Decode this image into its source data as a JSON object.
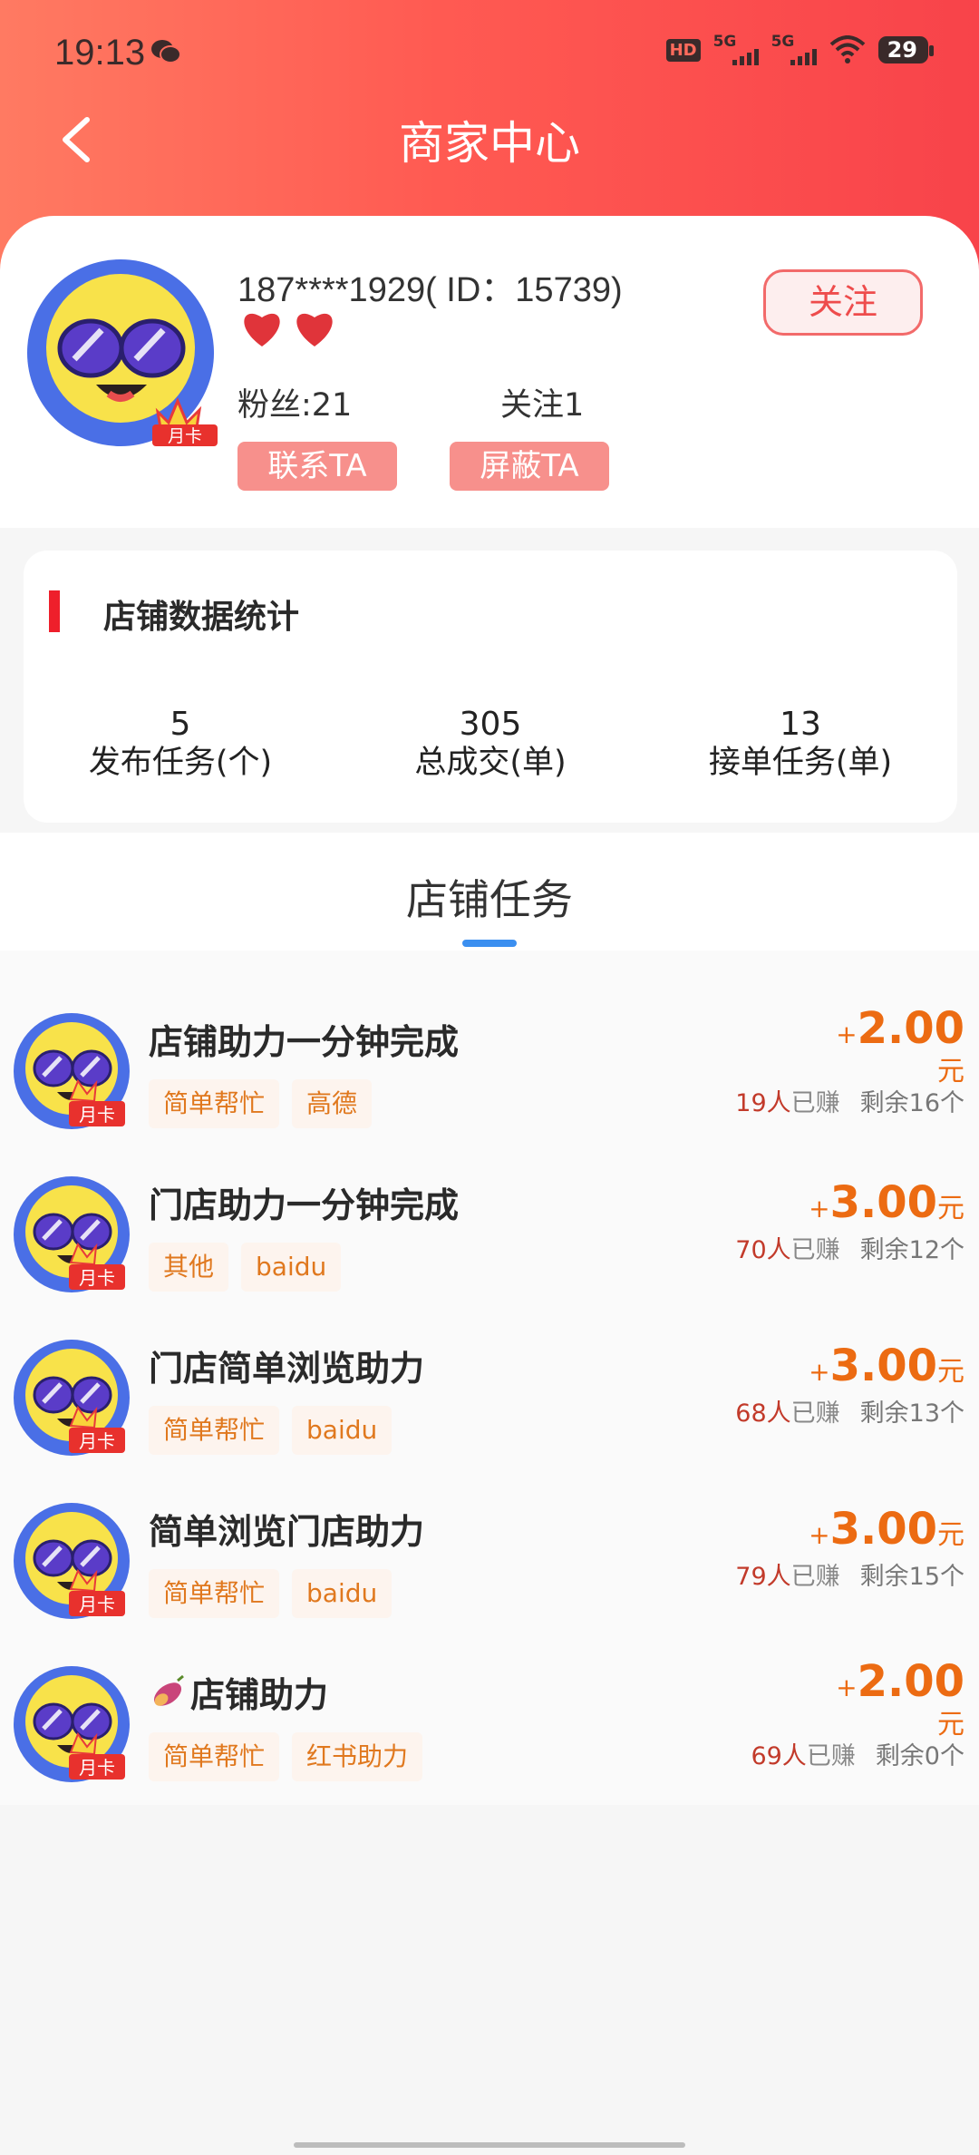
{
  "status_bar": {
    "time": "19:13",
    "battery": "29",
    "net": "5G",
    "hd": "HD"
  },
  "nav": {
    "title": "商家中心"
  },
  "profile": {
    "name": "187****1929( ID：15739)",
    "fans": "粉丝:21",
    "follows": "关注1",
    "contact_label": "联系TA",
    "block_label": "屏蔽TA",
    "follow_label": "关注",
    "badge": "月卡"
  },
  "stats": {
    "title": "店铺数据统计",
    "items": [
      {
        "value": "5",
        "label": "发布任务(个)"
      },
      {
        "value": "305",
        "label": "总成交(单)"
      },
      {
        "value": "13",
        "label": "接单任务(单)"
      }
    ]
  },
  "tasks_section": {
    "title": "店铺任务"
  },
  "tasks": [
    {
      "title": "店铺助力一分钟完成",
      "tags": [
        "简单帮忙",
        "高德"
      ],
      "plus": "+",
      "price": "2.00",
      "unit": "元",
      "earned_count": "19人",
      "earned_label": "已赚",
      "remaining": "剩余16个",
      "badge": "月卡"
    },
    {
      "title": "门店助力一分钟完成",
      "tags": [
        "其他",
        "baidu"
      ],
      "plus": "+",
      "price": "3.00",
      "unit": "元",
      "earned_count": "70人",
      "earned_label": "已赚",
      "remaining": "剩余12个",
      "badge": "月卡"
    },
    {
      "title": "门店简单浏览助力",
      "tags": [
        "简单帮忙",
        "baidu"
      ],
      "plus": "+",
      "price": "3.00",
      "unit": "元",
      "earned_count": "68人",
      "earned_label": "已赚",
      "remaining": "剩余13个",
      "badge": "月卡"
    },
    {
      "title": "简单浏览门店助力",
      "tags": [
        "简单帮忙",
        "baidu"
      ],
      "plus": "+",
      "price": "3.00",
      "unit": "元",
      "earned_count": "79人",
      "earned_label": "已赚",
      "remaining": "剩余15个",
      "badge": "月卡"
    },
    {
      "title": "店铺助力",
      "tags": [
        "简单帮忙",
        "红书助力"
      ],
      "plus": "+",
      "price": "2.00",
      "unit": "元",
      "earned_count": "69人",
      "earned_label": "已赚",
      "remaining": "剩余0个",
      "badge": "月卡"
    }
  ],
  "colors": {
    "accent": "#f8434a",
    "price": "#ec6b12",
    "tag_text": "#e0781e",
    "underline": "#3b8ff0"
  }
}
